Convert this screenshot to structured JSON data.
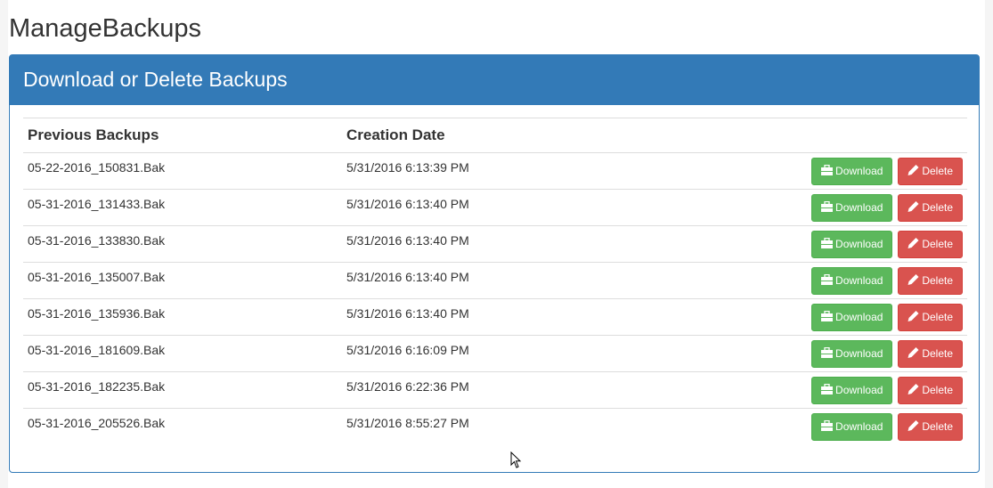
{
  "page_title": "ManageBackups",
  "panel": {
    "title": "Download or Delete Backups"
  },
  "table": {
    "headers": [
      "Previous Backups",
      "Creation Date",
      ""
    ],
    "rows": [
      {
        "file": "05-22-2016_150831.Bak",
        "date": "5/31/2016 6:13:39 PM"
      },
      {
        "file": "05-31-2016_131433.Bak",
        "date": "5/31/2016 6:13:40 PM"
      },
      {
        "file": "05-31-2016_133830.Bak",
        "date": "5/31/2016 6:13:40 PM"
      },
      {
        "file": "05-31-2016_135007.Bak",
        "date": "5/31/2016 6:13:40 PM"
      },
      {
        "file": "05-31-2016_135936.Bak",
        "date": "5/31/2016 6:13:40 PM"
      },
      {
        "file": "05-31-2016_181609.Bak",
        "date": "5/31/2016 6:16:09 PM"
      },
      {
        "file": "05-31-2016_182235.Bak",
        "date": "5/31/2016 6:22:36 PM"
      },
      {
        "file": "05-31-2016_205526.Bak",
        "date": "5/31/2016 8:55:27 PM"
      }
    ],
    "download_label": "Download",
    "delete_label": "Delete",
    "download_icon": "briefcase-icon",
    "delete_icon": "pencil-icon"
  },
  "colors": {
    "primary": "#337ab7",
    "success": "#5cb85c",
    "danger": "#d9534f"
  }
}
